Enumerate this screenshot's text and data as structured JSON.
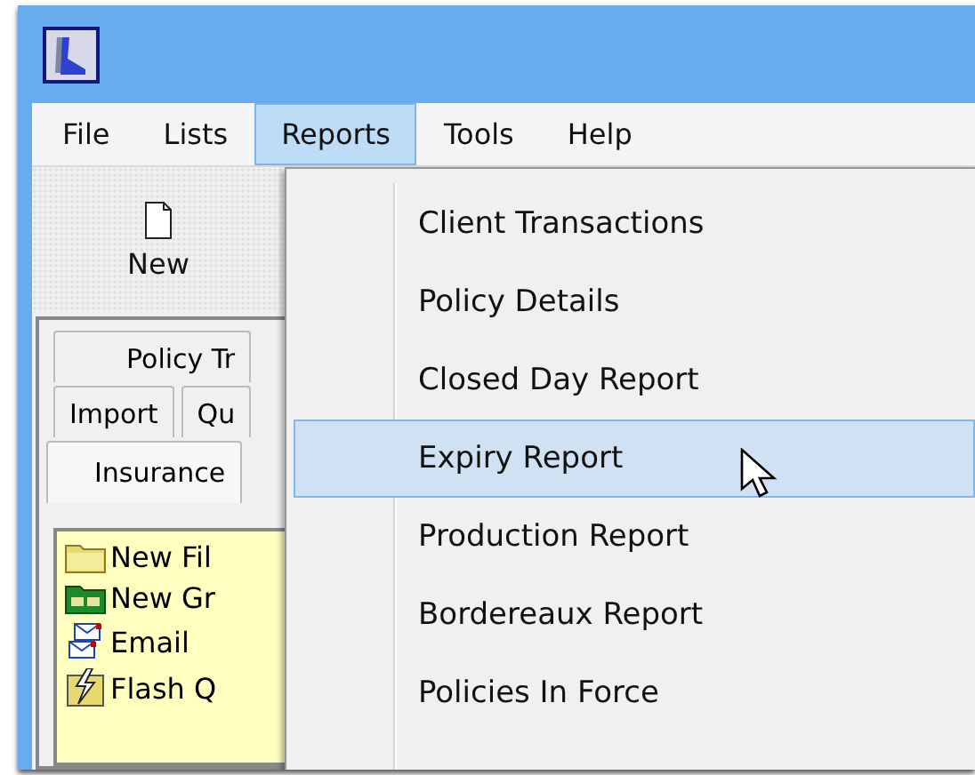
{
  "menu_bar": [
    {
      "label": "File",
      "selected": false
    },
    {
      "label": "Lists",
      "selected": false
    },
    {
      "label": "Reports",
      "selected": true
    },
    {
      "label": "Tools",
      "selected": false
    },
    {
      "label": "Help",
      "selected": false
    }
  ],
  "toolbar": [
    {
      "label": "New"
    }
  ],
  "tab_rows": [
    [
      {
        "label": "Policy Tr",
        "selected": false
      }
    ],
    [
      {
        "label": "Import",
        "selected": false
      },
      {
        "label": "Qu",
        "selected": false
      }
    ],
    [
      {
        "label": "Insurance",
        "selected": true
      }
    ]
  ],
  "task_list": [
    {
      "kind": "folder",
      "label": "New Fil"
    },
    {
      "kind": "group",
      "label": "New Gr"
    },
    {
      "kind": "email",
      "label": "Email"
    },
    {
      "kind": "flash",
      "label": "Flash Q"
    }
  ],
  "reports_menu": [
    {
      "label": "Client Transactions",
      "selected": false
    },
    {
      "label": "Policy Details",
      "selected": false
    },
    {
      "label": "Closed Day Report",
      "selected": false
    },
    {
      "label": "Expiry Report",
      "selected": true
    },
    {
      "label": "Production Report",
      "selected": false
    },
    {
      "label": "Bordereaux Report",
      "selected": false
    },
    {
      "label": "Policies In Force",
      "selected": false
    }
  ]
}
